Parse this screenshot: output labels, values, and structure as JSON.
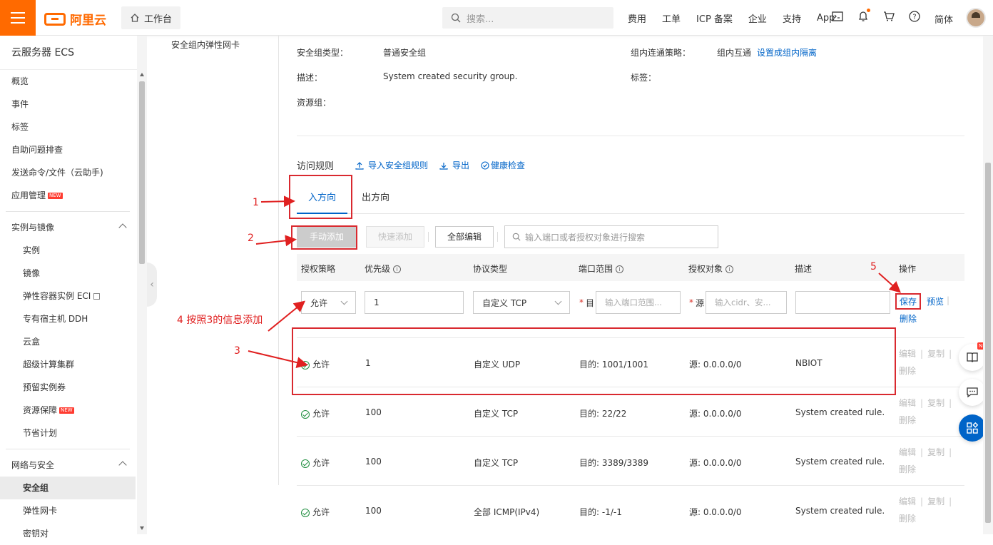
{
  "header": {
    "logo": "阿里云",
    "workbench": "工作台",
    "search_placeholder": "搜索...",
    "nav": [
      "费用",
      "工单",
      "ICP 备案",
      "企业",
      "支持",
      "App"
    ],
    "lang": "简体"
  },
  "sidebar": {
    "title": "云服务器 ECS",
    "top_items": [
      "概览",
      "事件",
      "标签",
      "自助问题排查",
      "发送命令/文件（云助手)",
      "应用管理"
    ],
    "group1": "实例与镜像",
    "group1_items": [
      "实例",
      "镜像",
      "弹性容器实例 ECI",
      "专有宿主机 DDH",
      "云盒",
      "超级计算集群",
      "预留实例券",
      "资源保障",
      "节省计划"
    ],
    "group2": "网络与安全",
    "group2_items": [
      "安全组",
      "弹性网卡",
      "密钥对"
    ],
    "new_badge": "NEW"
  },
  "detail": {
    "left_tab": "安全组内弹性网卡",
    "type_label": "安全组类型：",
    "type_value": "普通安全组",
    "policy_label": "组内连通策略：",
    "policy_value": "组内互通",
    "policy_link": "设置成组内隔离",
    "desc_label": "描述：",
    "desc_value": "System created security group.",
    "tag_label": "标签：",
    "rg_label": "资源组："
  },
  "rules": {
    "title": "访问规则",
    "import": "导入安全组规则",
    "export": "导出",
    "health": "健康检查",
    "tab_in": "入方向",
    "tab_out": "出方向",
    "btn_manual": "手动添加",
    "btn_quick": "快速添加",
    "btn_edit_all": "全部编辑",
    "search_placeholder": "输入端口或者授权对象进行搜索",
    "columns": [
      "授权策略",
      "优先级",
      "协议类型",
      "端口范围",
      "授权对象",
      "描述",
      "操作"
    ]
  },
  "edit_row": {
    "policy": "允许",
    "priority": "1",
    "protocol": "自定义 TCP",
    "port_prefix": "目",
    "port_placeholder": "输入端口范围...",
    "src_prefix": "源",
    "src_placeholder": "输入cidr、安...",
    "save": "保存",
    "preview": "预览",
    "delete": "删除"
  },
  "ops_labels": {
    "edit": "编辑",
    "copy": "复制",
    "delete": "删除"
  },
  "table_rows": [
    {
      "policy": "允许",
      "priority": "1",
      "protocol": "自定义 UDP",
      "port": "目的: 1001/1001",
      "source": "源: 0.0.0.0/0",
      "desc": "NBIOT"
    },
    {
      "policy": "允许",
      "priority": "100",
      "protocol": "自定义 TCP",
      "port": "目的: 22/22",
      "source": "源: 0.0.0.0/0",
      "desc": "System created rule."
    },
    {
      "policy": "允许",
      "priority": "100",
      "protocol": "自定义 TCP",
      "port": "目的: 3389/3389",
      "source": "源: 0.0.0.0/0",
      "desc": "System created rule."
    },
    {
      "policy": "允许",
      "priority": "100",
      "protocol": "全部 ICMP(IPv4)",
      "port": "目的: -1/-1",
      "source": "源: 0.0.0.0/0",
      "desc": "System created rule."
    }
  ],
  "annotations": {
    "a1": "1",
    "a2": "2",
    "a3": "3",
    "a4": "4 按照3的信息添加",
    "a5": "5"
  },
  "colors": {
    "brand": "#ff6a00",
    "link": "#0064c8",
    "annotation": "#e02020"
  }
}
